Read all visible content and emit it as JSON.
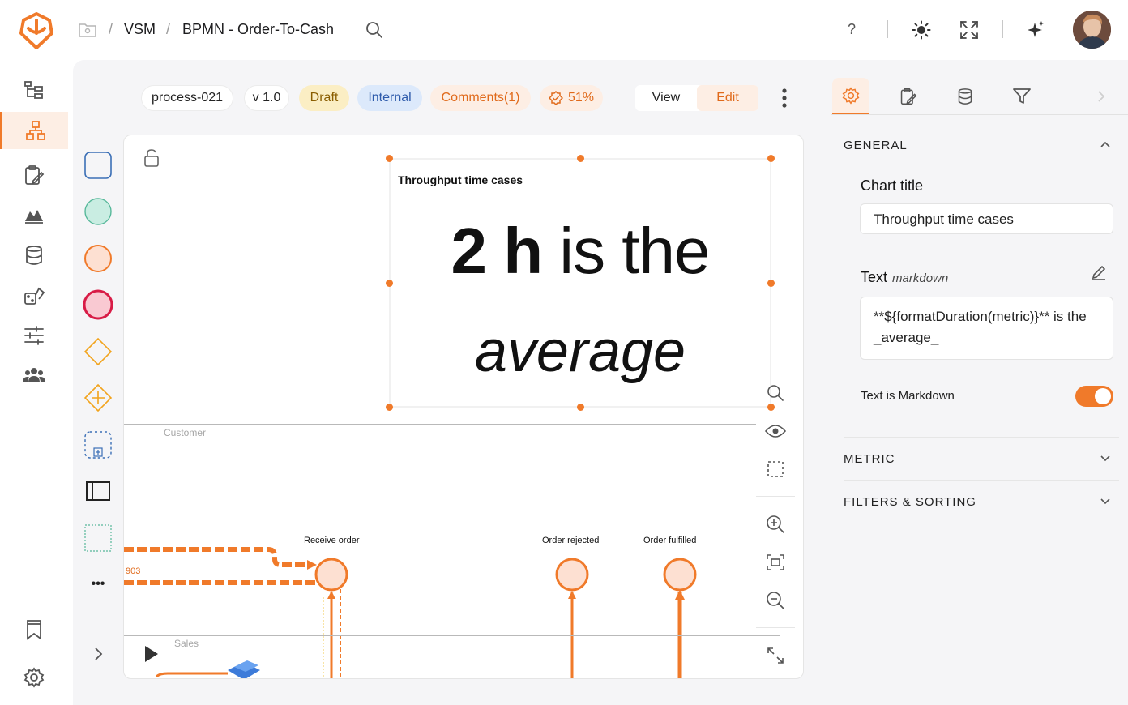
{
  "breadcrumb": {
    "item1": "VSM",
    "sep": "/",
    "item2": "BPMN - Order-To-Cash"
  },
  "header_icons": [
    "folder-icon",
    "search-icon",
    "help-icon",
    "theme-sun-icon",
    "fullscreen-icon",
    "ai-sparkle-icon"
  ],
  "header": {
    "help": "?"
  },
  "left_nav": [
    "hierarchy-icon",
    "process-model-icon",
    "clipboard-edit-icon",
    "mountain-chart-icon",
    "database-icon",
    "dice-icon",
    "sliders-icon",
    "users-icon",
    "bookmark-icon",
    "settings-icon"
  ],
  "toolbar": {
    "process_id": "process-021",
    "version": "v 1.0",
    "status": "Draft",
    "visibility": "Internal",
    "comments": "Comments(1)",
    "completion": "51%",
    "view_label": "View",
    "edit_label": "Edit"
  },
  "palette": [
    "task-shape",
    "start-event-shape",
    "intermediate-event-shape",
    "end-event-shape",
    "exclusive-gateway-shape",
    "parallel-gateway-shape",
    "subprocess-shape",
    "pool-shape",
    "group-shape",
    "more-icon"
  ],
  "palette_more": "•••",
  "widget": {
    "title": "Throughput time cases",
    "value": "2 h",
    "rest": " is the",
    "emphasis": "average"
  },
  "canvas": {
    "lane1": "Customer",
    "lane2": "Sales",
    "flow_count": "903",
    "events": [
      "Receive order",
      "Order rejected",
      "Order fulfilled"
    ]
  },
  "colors": {
    "accent": "#f07a2a",
    "accent_light": "#fdeee4",
    "event_fill": "#fde0d2"
  },
  "panel": {
    "tabs": [
      "settings-gear-icon",
      "clipboard-icon",
      "database-icon",
      "filter-icon"
    ],
    "general": "GENERAL",
    "chart_title_label": "Chart title",
    "chart_title_value": "Throughput time cases",
    "text_label": "Text",
    "text_hint": "markdown",
    "text_value": "**${formatDuration(metric)}** is the _average_",
    "markdown_toggle_label": "Text is Markdown",
    "markdown_toggle_on": true,
    "metric": "METRIC",
    "filters": "FILTERS & SORTING"
  }
}
